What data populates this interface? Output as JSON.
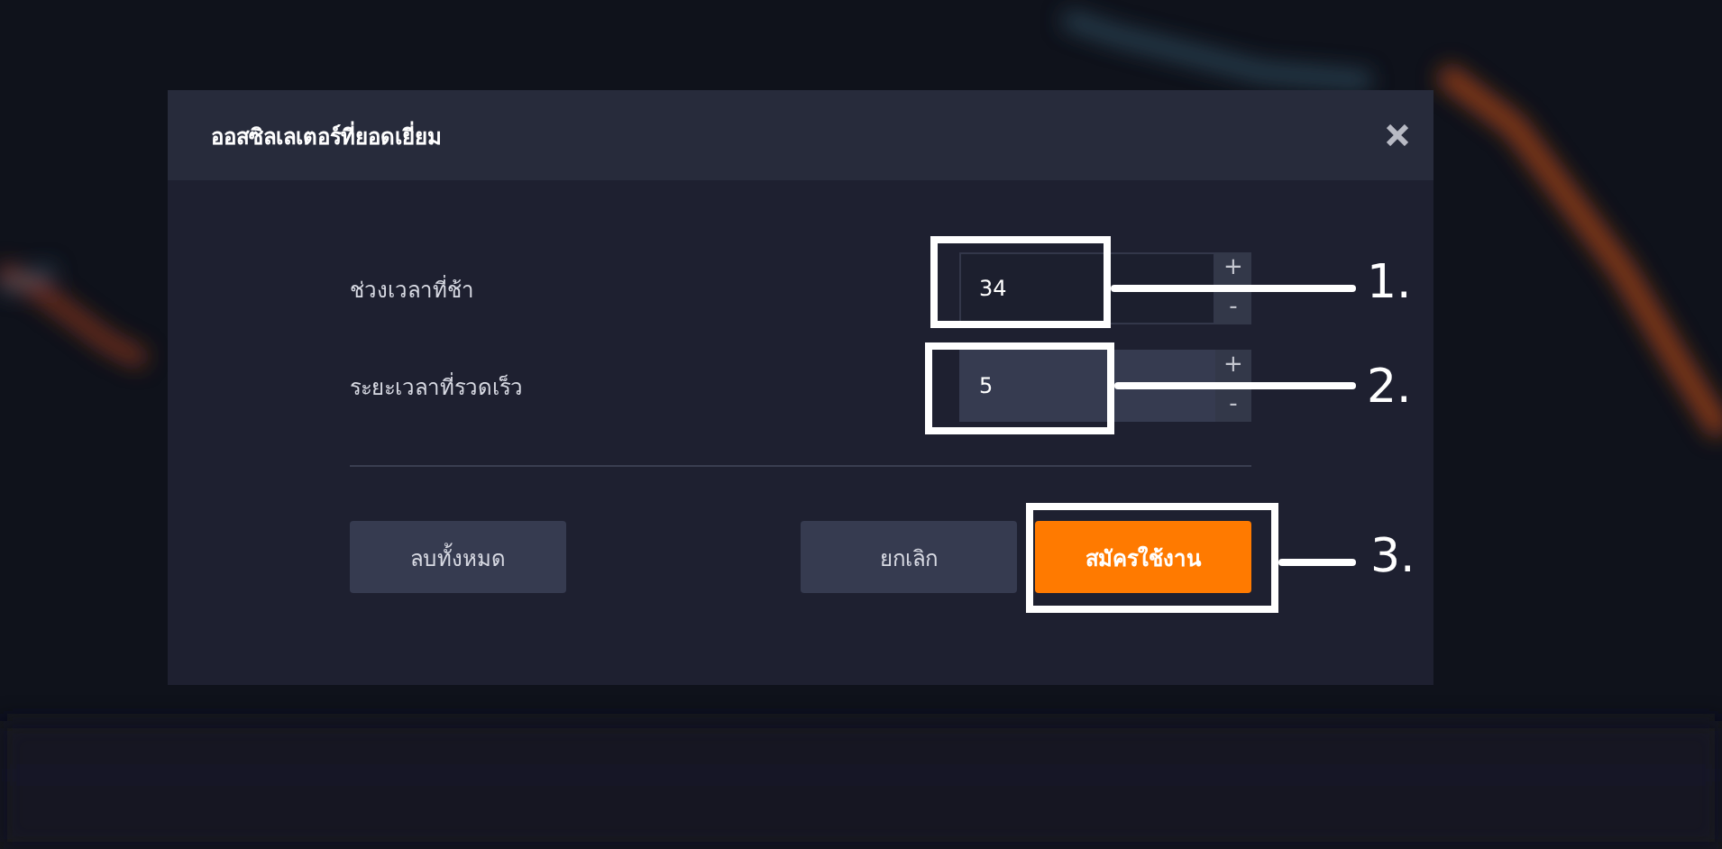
{
  "dialog": {
    "title": "ออสซิลเลเตอร์ที่ยอดเยี่ยม",
    "fields": [
      {
        "label": "ช่วงเวลาที่ช้า",
        "value": "34",
        "focused": true,
        "increment": "+",
        "decrement": "-"
      },
      {
        "label": "ระยะเวลาที่รวดเร็ว",
        "value": "5",
        "focused": false,
        "increment": "+",
        "decrement": "-"
      }
    ],
    "buttons": [
      {
        "label": "ลบทั้งหมด",
        "kind": "secondary"
      },
      {
        "label": "ยกเลิก",
        "kind": "secondary"
      },
      {
        "label": "สมัครใช้งาน",
        "kind": "primary"
      }
    ]
  },
  "annotations": [
    {
      "label": "1."
    },
    {
      "label": "2."
    },
    {
      "label": "3."
    }
  ]
}
